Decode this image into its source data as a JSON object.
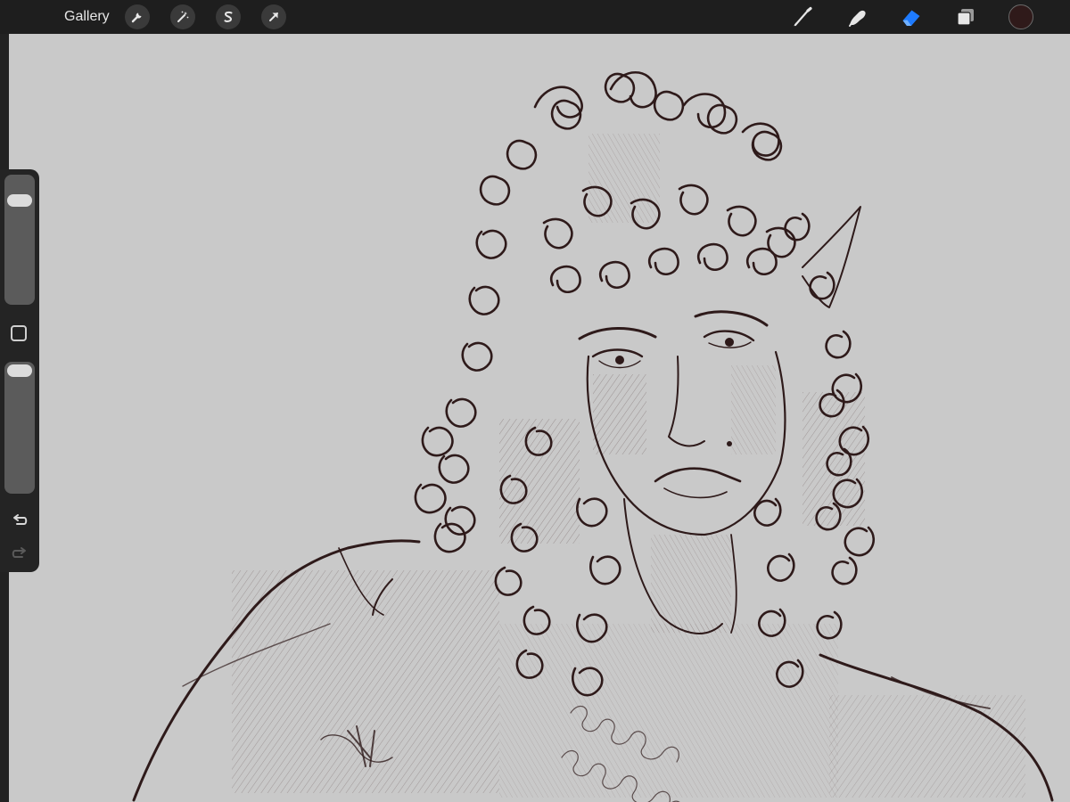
{
  "app": {
    "gallery_label": "Gallery"
  },
  "toolbar_left": [
    {
      "name": "actions",
      "icon": "wrench-icon"
    },
    {
      "name": "adjustments",
      "icon": "magic-wand-icon"
    },
    {
      "name": "selection",
      "icon": "selection-s-icon"
    },
    {
      "name": "transform",
      "icon": "arrow-cursor-icon"
    }
  ],
  "toolbar_right": [
    {
      "name": "brush",
      "icon": "brush-icon",
      "active": false
    },
    {
      "name": "smudge",
      "icon": "smudge-finger-icon",
      "active": false
    },
    {
      "name": "eraser",
      "icon": "eraser-icon",
      "active": true
    },
    {
      "name": "layers",
      "icon": "layers-icon",
      "active": false
    }
  ],
  "current_color": "#2f1a1a",
  "accent_color": "#1e7bff",
  "canvas_color": "#c9c9c9",
  "ink_color": "#2e1a1a",
  "sidebar": {
    "brush_size_level": 0.85,
    "opacity_level": 1.0,
    "undo_icon": "undo-icon",
    "redo_icon": "redo-icon",
    "modify_icon": "square-modify-icon"
  }
}
